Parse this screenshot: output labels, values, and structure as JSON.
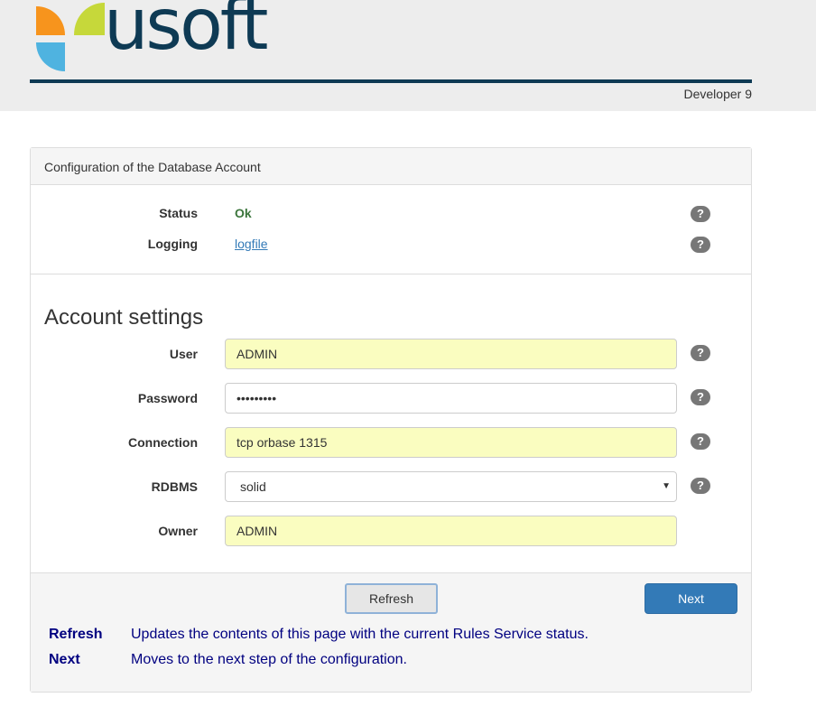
{
  "header": {
    "logo_text": "usoft",
    "version": "Developer 9",
    "colors": {
      "navy": "#0e3a54",
      "orange": "#f7941d",
      "green": "#c6d83a",
      "blue": "#4fb3e0"
    }
  },
  "panel": {
    "heading": "Configuration of the Database Account",
    "status": {
      "label": "Status",
      "value": "Ok",
      "help": "?"
    },
    "logging": {
      "label": "Logging",
      "link": "logfile",
      "help": "?"
    },
    "section_title": "Account settings",
    "fields": {
      "user": {
        "label": "User",
        "value": "ADMIN",
        "help": "?"
      },
      "password": {
        "label": "Password",
        "value": "•••••••••",
        "help": "?"
      },
      "connection": {
        "label": "Connection",
        "value": "tcp orbase 1315",
        "help": "?"
      },
      "rdbms": {
        "label": "RDBMS",
        "value": "solid",
        "arrow": "▼",
        "help": "?"
      },
      "owner": {
        "label": "Owner",
        "value": "ADMIN"
      }
    }
  },
  "actions": {
    "refresh_label": "Refresh",
    "next_label": "Next"
  },
  "help_text": [
    {
      "term": "Refresh",
      "description": "Updates the contents of this page with the current Rules Service status."
    },
    {
      "term": "Next",
      "description": "Moves to the next step of the configuration."
    }
  ]
}
